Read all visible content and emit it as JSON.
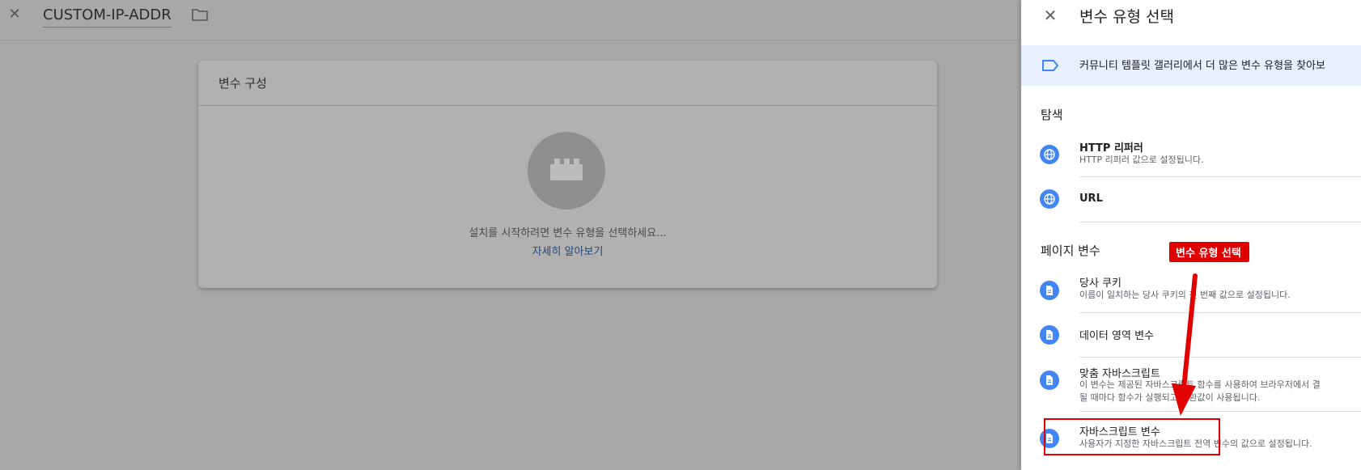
{
  "editor": {
    "workspace_name": "CUSTOM-IP-ADDR",
    "card_title": "변수 구성",
    "card_hint": "설치를 시작하려면 변수 유형을 선택하세요...",
    "learn_more": "자세히 알아보기"
  },
  "panel": {
    "title": "변수 유형 선택",
    "banner_text": "커뮤니티 템플릿 갤러리에서 더 많은 변수 유형을 찾아보",
    "sections": [
      {
        "heading": "탐색",
        "items": [
          {
            "name": "HTTP 리퍼러",
            "desc": "HTTP 리퍼러 값으로 설정됩니다.",
            "icon": "globe-icon"
          },
          {
            "name": "URL",
            "desc": "",
            "icon": "globe-icon"
          }
        ]
      },
      {
        "heading": "페이지 변수",
        "items": [
          {
            "name": "당사 쿠키",
            "desc": "이름이 일치하는 당사 쿠키의 첫 번째 값으로 설정됩니다.",
            "icon": "document-icon"
          },
          {
            "name": "데이터 영역 변수",
            "desc": "",
            "icon": "document-icon"
          },
          {
            "name": "맞춤 자바스크립트",
            "desc": "이 변수는 제공된 자바스크립트 함수를 사용하여 브라우저에서 결",
            "desc2": "될 때마다 함수가 실행되고 반환값이 사용됩니다.",
            "icon": "document-icon"
          },
          {
            "name": "자바스크립트 변수",
            "desc": "사용자가 지정한 자바스크립트 전역 변수의 값으로 설정됩니다.",
            "icon": "document-icon"
          }
        ]
      }
    ]
  },
  "annotation": {
    "callout_text": "변수 유형 선택",
    "color": "#e10000"
  },
  "colors": {
    "accent": "#4285f4",
    "banner_bg": "#e8f0fe",
    "link": "#24487e"
  }
}
